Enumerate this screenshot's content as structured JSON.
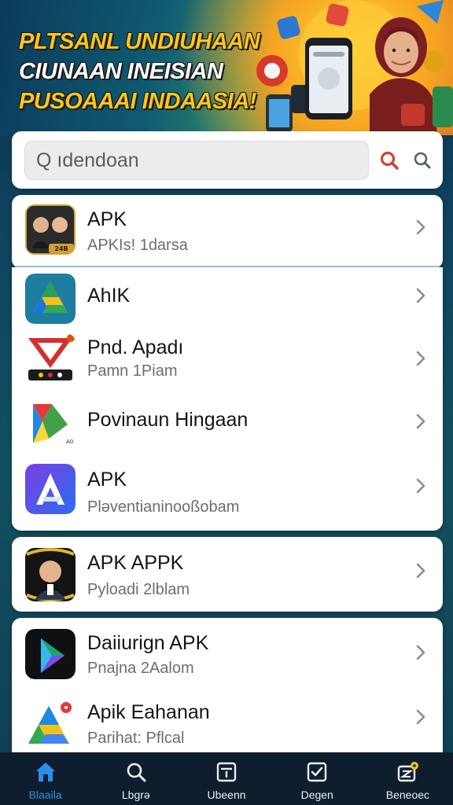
{
  "banner": {
    "line1": "PLTSANL UNDIUHAAN",
    "line2": "CIUNAAN INEISIAN",
    "line3": "PUSOAAAI INDAASIA!"
  },
  "search": {
    "placeholder": "Q ıdendoan"
  },
  "list_groups": [
    {
      "items": [
        {
          "title": "APK",
          "subtitle": "APKIs! 1darsa",
          "icon": "portrait-pair-icon",
          "badge": "24B"
        }
      ]
    },
    {
      "items": [
        {
          "title": "AhIK",
          "subtitle": "",
          "icon": "drive-triangle-icon"
        },
        {
          "title": "Pnd. Apadı",
          "subtitle": "Pamn 1Piam",
          "icon": "red-v-logo-icon"
        },
        {
          "title": "Povinaun Hingaan",
          "subtitle": "",
          "icon": "colorful-p-logo-icon"
        },
        {
          "title": "APK",
          "subtitle": "Pləventianinooßobam",
          "icon": "purple-a-logo-icon"
        }
      ]
    },
    {
      "items": [
        {
          "title": "APK APPK",
          "subtitle": "Pyloadi 2lblam",
          "icon": "portrait-gold-frame-icon"
        }
      ]
    },
    {
      "items": [
        {
          "title": "Daiiurign APK",
          "subtitle": "Pnajna 2Aalom",
          "icon": "play-triangle-dark-icon"
        },
        {
          "title": "Apik Eahanan",
          "subtitle": "Parihat: Pflcal",
          "icon": "drive-triangle-badge-icon"
        }
      ]
    }
  ],
  "bottom_nav": [
    {
      "label": "Blaaila",
      "icon": "home-icon",
      "active": true
    },
    {
      "label": "Lbgrə",
      "icon": "search-icon",
      "active": false
    },
    {
      "label": "Ubeenn",
      "icon": "download-box-icon",
      "active": false
    },
    {
      "label": "Degen",
      "icon": "checkbox-icon",
      "active": false
    },
    {
      "label": "Beneoec",
      "icon": "settings-badge-icon",
      "active": false
    }
  ],
  "colors": {
    "accent": "#2b8fe8",
    "banner_yellow": "#ffc61a",
    "search_red": "#d6412f"
  }
}
